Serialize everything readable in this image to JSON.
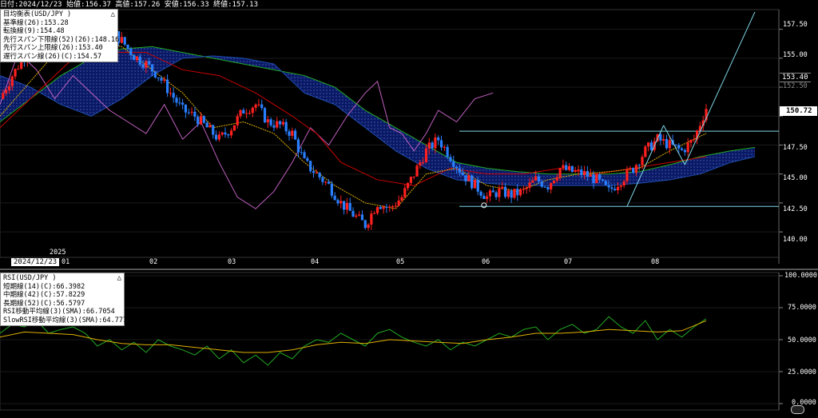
{
  "header": {
    "info_text": "日付:2024/12/23 始値:156.37 高値:157.26 安値:156.33 終値:157.13"
  },
  "main_legend": {
    "title": "目均衡表(USD/JPY )",
    "lines": [
      {
        "text": "基準線(26):153.28",
        "color": "#cc0000"
      },
      {
        "text": "転換線(9):154.48",
        "color": "#e0b000"
      },
      {
        "text": "先行スパン下限線(52)(26):148.16",
        "color": "#1f4fb0"
      },
      {
        "text": "先行スパン上限線(26):153.40",
        "color": "#1f4fb0"
      },
      {
        "text": "遅行スパン線(26)(C):154.57",
        "color": "#c060c0"
      }
    ],
    "close_glyph": "△"
  },
  "rsi_legend": {
    "title": "RSI(USD/JPY )",
    "lines": [
      {
        "text": "短期線(14)(C):66.3982",
        "color": "#22aa22"
      },
      {
        "text": "中期線(42)(C):57.8229",
        "color": "#e0b000"
      },
      {
        "text": "長期線(52)(C):56.5797",
        "color": "#1f4fb0"
      },
      {
        "text": "RSI移動平均線(3)(SMA):66.7054",
        "color": "#cc0000"
      },
      {
        "text": "SlowRSI移動平均線(3)(SMA):64.7777",
        "color": "#e0b000"
      }
    ],
    "close_glyph": "△"
  },
  "price_axis": {
    "ticks": [
      "157.50",
      "155.00",
      "152.50",
      "150.00",
      "147.50",
      "145.00",
      "142.50",
      "140.00"
    ],
    "tag_upper": "153.40",
    "tag_last": "150.72"
  },
  "rsi_axis": {
    "ticks": [
      "100.0000",
      "75.0000",
      "50.0000",
      "25.0000",
      "0.0000"
    ]
  },
  "time_axis": {
    "year_label": "2025",
    "cursor_date": "2024/12/23",
    "months": [
      "01",
      "02",
      "03",
      "04",
      "05",
      "06",
      "07",
      "08"
    ]
  },
  "colors": {
    "background": "#000000",
    "bull_candle": "#ff2020",
    "bear_candle": "#2a7fff",
    "kijun": "#cc0000",
    "tenkan": "#e0b000",
    "chikou": "#c060c0",
    "cloud_fill": "#0a1a6a",
    "cloud_edge_a": "#1f4fb0",
    "cloud_edge_b": "#22aa22",
    "trendline": "#7fd6e6",
    "rsi_short": "#22aa22",
    "rsi_slow": "#e0b000"
  },
  "chart_data": [
    {
      "type": "candlestick",
      "title": "目均衡表(USD/JPY )",
      "ylim": [
        137.8,
        159.2
      ],
      "yticks": [
        140,
        142.5,
        145,
        147.5,
        150,
        152.5,
        155,
        157.5
      ],
      "x_months": [
        "01",
        "02",
        "03",
        "04",
        "05",
        "06",
        "07",
        "08"
      ],
      "close_path": [
        [
          0,
          151.5
        ],
        [
          4,
          153.5
        ],
        [
          8,
          155.2
        ],
        [
          12,
          156.5
        ],
        [
          16,
          157.2
        ],
        [
          20,
          157.1
        ],
        [
          24,
          156.8
        ],
        [
          28,
          157.5
        ],
        [
          32,
          158.0
        ],
        [
          36,
          157.5
        ],
        [
          40,
          156.5
        ],
        [
          44,
          155.2
        ],
        [
          48,
          154.5
        ],
        [
          52,
          153.5
        ],
        [
          56,
          152.0
        ],
        [
          60,
          150.5
        ],
        [
          64,
          150.0
        ],
        [
          68,
          149.0
        ],
        [
          72,
          148.0
        ],
        [
          76,
          149.0
        ],
        [
          80,
          150.5
        ],
        [
          84,
          151.0
        ],
        [
          88,
          149.5
        ],
        [
          92,
          149.2
        ],
        [
          96,
          148.5
        ],
        [
          100,
          146.0
        ],
        [
          104,
          145.0
        ],
        [
          108,
          144.0
        ],
        [
          112,
          142.5
        ],
        [
          116,
          141.5
        ],
        [
          120,
          140.6
        ],
        [
          124,
          142.5
        ],
        [
          128,
          142.0
        ],
        [
          132,
          143.0
        ],
        [
          136,
          145.0
        ],
        [
          140,
          147.0
        ],
        [
          144,
          148.0
        ],
        [
          148,
          146.5
        ],
        [
          152,
          145.0
        ],
        [
          156,
          144.0
        ],
        [
          160,
          143.0
        ],
        [
          164,
          143.5
        ],
        [
          168,
          143.2
        ],
        [
          172,
          143.5
        ],
        [
          176,
          144.5
        ],
        [
          180,
          144.0
        ],
        [
          184,
          145.5
        ],
        [
          188,
          145.2
        ],
        [
          192,
          145.0
        ],
        [
          196,
          144.5
        ],
        [
          200,
          143.5
        ],
        [
          204,
          144.5
        ],
        [
          208,
          145.5
        ],
        [
          212,
          147.0
        ],
        [
          216,
          148.0
        ],
        [
          220,
          147.5
        ],
        [
          224,
          147.0
        ],
        [
          228,
          148.0
        ],
        [
          232,
          150.72
        ]
      ],
      "tenkan": [
        [
          0,
          150.0
        ],
        [
          10,
          153.0
        ],
        [
          20,
          156.0
        ],
        [
          30,
          156.5
        ],
        [
          40,
          156.0
        ],
        [
          50,
          154.0
        ],
        [
          60,
          152.0
        ],
        [
          70,
          149.0
        ],
        [
          80,
          149.5
        ],
        [
          90,
          148.5
        ],
        [
          100,
          146.0
        ],
        [
          110,
          144.0
        ],
        [
          120,
          142.5
        ],
        [
          130,
          142.0
        ],
        [
          140,
          145.0
        ],
        [
          150,
          145.5
        ],
        [
          160,
          144.0
        ],
        [
          170,
          143.5
        ],
        [
          180,
          144.5
        ],
        [
          190,
          145.0
        ],
        [
          200,
          145.2
        ],
        [
          210,
          145.5
        ],
        [
          220,
          147.0
        ],
        [
          232,
          148.5
        ]
      ],
      "kijun": [
        [
          0,
          149.0
        ],
        [
          12,
          152.0
        ],
        [
          24,
          155.0
        ],
        [
          36,
          155.5
        ],
        [
          48,
          155.5
        ],
        [
          60,
          154.0
        ],
        [
          72,
          153.5
        ],
        [
          84,
          152.0
        ],
        [
          96,
          150.0
        ],
        [
          104,
          148.5
        ],
        [
          112,
          146.0
        ],
        [
          124,
          144.5
        ],
        [
          136,
          144.0
        ],
        [
          148,
          145.5
        ],
        [
          160,
          145.0
        ],
        [
          172,
          145.0
        ],
        [
          184,
          145.5
        ],
        [
          196,
          145.0
        ],
        [
          208,
          145.5
        ],
        [
          220,
          146.0
        ],
        [
          232,
          146.5
        ]
      ],
      "chikou": [
        [
          0,
          151.0
        ],
        [
          6,
          155.5
        ],
        [
          12,
          154.0
        ],
        [
          18,
          151.5
        ],
        [
          24,
          153.5
        ],
        [
          30,
          152.0
        ],
        [
          36,
          150.5
        ],
        [
          42,
          149.5
        ],
        [
          48,
          148.5
        ],
        [
          54,
          151.0
        ],
        [
          60,
          148.0
        ],
        [
          66,
          149.5
        ],
        [
          72,
          146.0
        ],
        [
          78,
          143.0
        ],
        [
          84,
          142.0
        ],
        [
          90,
          143.5
        ],
        [
          96,
          146.0
        ],
        [
          102,
          149.0
        ],
        [
          108,
          147.5
        ],
        [
          114,
          150.0
        ],
        [
          120,
          152.0
        ],
        [
          124,
          153.0
        ],
        [
          128,
          149.0
        ],
        [
          132,
          148.5
        ],
        [
          136,
          147.0
        ],
        [
          140,
          148.5
        ],
        [
          144,
          150.5
        ],
        [
          150,
          149.5
        ],
        [
          156,
          151.5
        ],
        [
          162,
          152.0
        ]
      ],
      "senkou_a": [
        [
          0,
          149.5
        ],
        [
          10,
          151.5
        ],
        [
          20,
          153.5
        ],
        [
          30,
          155.0
        ],
        [
          40,
          155.8
        ],
        [
          50,
          156.0
        ],
        [
          60,
          155.5
        ],
        [
          70,
          155.0
        ],
        [
          80,
          154.5
        ],
        [
          90,
          154.0
        ],
        [
          100,
          153.5
        ],
        [
          110,
          152.5
        ],
        [
          120,
          150.5
        ],
        [
          130,
          149.0
        ],
        [
          140,
          147.5
        ],
        [
          150,
          146.0
        ],
        [
          160,
          145.5
        ],
        [
          170,
          145.2
        ],
        [
          180,
          145.0
        ],
        [
          190,
          145.0
        ],
        [
          200,
          145.0
        ],
        [
          210,
          145.2
        ],
        [
          220,
          145.8
        ],
        [
          230,
          146.5
        ],
        [
          240,
          147.0
        ],
        [
          248,
          147.3
        ]
      ],
      "senkou_b": [
        [
          0,
          153.5
        ],
        [
          10,
          152.5
        ],
        [
          20,
          151.0
        ],
        [
          30,
          150.0
        ],
        [
          40,
          151.5
        ],
        [
          50,
          153.5
        ],
        [
          60,
          155.0
        ],
        [
          70,
          155.2
        ],
        [
          80,
          155.0
        ],
        [
          90,
          154.5
        ],
        [
          100,
          152.0
        ],
        [
          110,
          151.0
        ],
        [
          120,
          149.0
        ],
        [
          130,
          147.0
        ],
        [
          140,
          145.5
        ],
        [
          150,
          144.5
        ],
        [
          160,
          144.2
        ],
        [
          170,
          144.0
        ],
        [
          180,
          144.0
        ],
        [
          190,
          144.0
        ],
        [
          200,
          144.0
        ],
        [
          210,
          144.2
        ],
        [
          220,
          144.5
        ],
        [
          230,
          145.0
        ],
        [
          240,
          146.0
        ],
        [
          248,
          146.5
        ]
      ],
      "horizontal_levels": [
        148.7,
        142.2
      ],
      "annotations": {
        "upper_tag": 153.4,
        "last_tag": 150.72
      }
    },
    {
      "type": "line",
      "title": "RSI(USD/JPY )",
      "ylim": [
        0,
        100
      ],
      "yticks": [
        0,
        25,
        50,
        75,
        100
      ],
      "series": [
        {
          "name": "短期線(14)(C)",
          "values": [
            [
              0,
              55
            ],
            [
              4,
              62
            ],
            [
              8,
              60
            ],
            [
              12,
              65
            ],
            [
              16,
              55
            ],
            [
              20,
              58
            ],
            [
              24,
              60
            ],
            [
              28,
              55
            ],
            [
              32,
              45
            ],
            [
              36,
              50
            ],
            [
              40,
              42
            ],
            [
              44,
              48
            ],
            [
              48,
              40
            ],
            [
              52,
              50
            ],
            [
              56,
              45
            ],
            [
              60,
              42
            ],
            [
              64,
              38
            ],
            [
              68,
              45
            ],
            [
              72,
              35
            ],
            [
              76,
              42
            ],
            [
              80,
              32
            ],
            [
              84,
              38
            ],
            [
              88,
              30
            ],
            [
              92,
              40
            ],
            [
              96,
              35
            ],
            [
              100,
              45
            ],
            [
              104,
              50
            ],
            [
              108,
              48
            ],
            [
              112,
              55
            ],
            [
              116,
              50
            ],
            [
              120,
              45
            ],
            [
              124,
              55
            ],
            [
              128,
              58
            ],
            [
              132,
              52
            ],
            [
              136,
              48
            ],
            [
              140,
              45
            ],
            [
              144,
              50
            ],
            [
              148,
              42
            ],
            [
              152,
              48
            ],
            [
              156,
              45
            ],
            [
              160,
              50
            ],
            [
              164,
              55
            ],
            [
              168,
              52
            ],
            [
              172,
              58
            ],
            [
              176,
              60
            ],
            [
              180,
              50
            ],
            [
              184,
              58
            ],
            [
              188,
              62
            ],
            [
              192,
              55
            ],
            [
              196,
              58
            ],
            [
              200,
              68
            ],
            [
              204,
              60
            ],
            [
              208,
              55
            ],
            [
              212,
              65
            ],
            [
              216,
              50
            ],
            [
              220,
              58
            ],
            [
              224,
              52
            ],
            [
              228,
              60
            ],
            [
              232,
              66.4
            ]
          ]
        },
        {
          "name": "SlowRSI移動平均線(3)(SMA)",
          "values": [
            [
              0,
              52
            ],
            [
              8,
              56
            ],
            [
              16,
              55
            ],
            [
              24,
              54
            ],
            [
              32,
              50
            ],
            [
              40,
              47
            ],
            [
              48,
              46
            ],
            [
              56,
              46
            ],
            [
              64,
              44
            ],
            [
              72,
              42
            ],
            [
              80,
              40
            ],
            [
              88,
              40
            ],
            [
              96,
              42
            ],
            [
              104,
              46
            ],
            [
              112,
              48
            ],
            [
              120,
              47
            ],
            [
              128,
              50
            ],
            [
              136,
              49
            ],
            [
              144,
              48
            ],
            [
              152,
              47
            ],
            [
              160,
              50
            ],
            [
              168,
              52
            ],
            [
              176,
              55
            ],
            [
              184,
              55
            ],
            [
              192,
              56
            ],
            [
              200,
              58
            ],
            [
              208,
              57
            ],
            [
              216,
              56
            ],
            [
              224,
              57
            ],
            [
              232,
              64.8
            ]
          ]
        }
      ]
    }
  ]
}
